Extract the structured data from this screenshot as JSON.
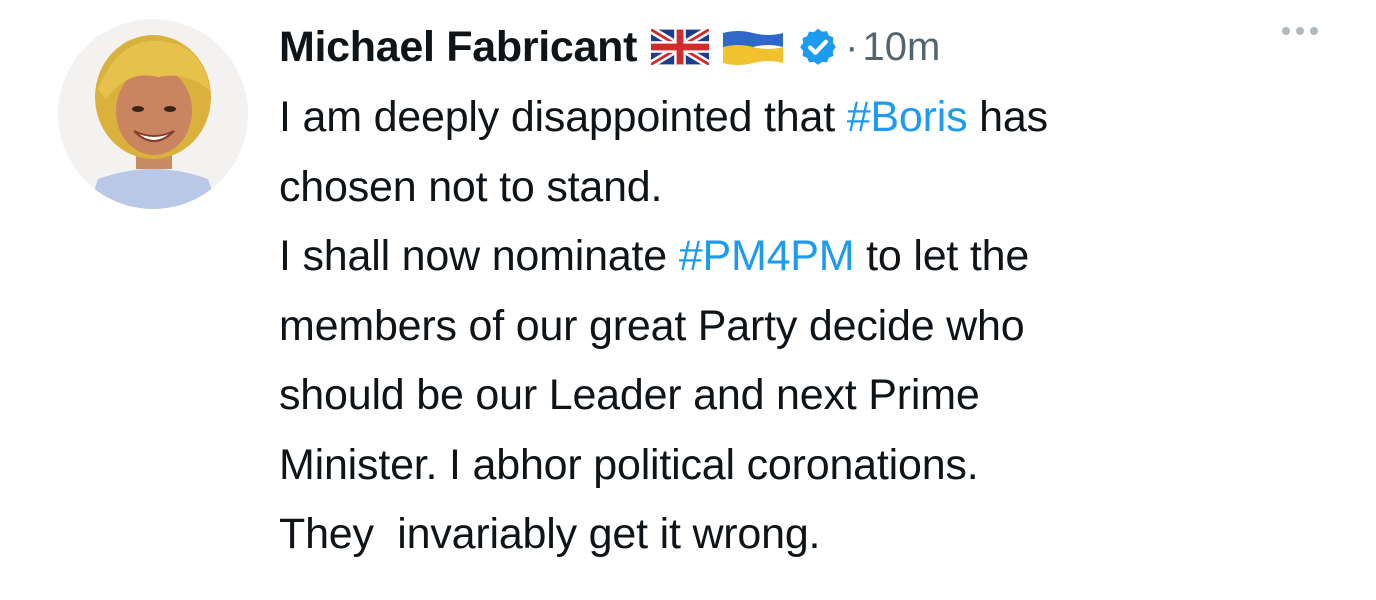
{
  "tweet": {
    "author_name": "Michael Fabricant",
    "flags": [
      "uk-flag-icon",
      "ukraine-flag-icon"
    ],
    "verified_icon": "verified-badge-icon",
    "separator": "·",
    "timestamp": "10m",
    "more_icon": "more-options-icon",
    "colors": {
      "text": "#0f1419",
      "secondary": "#536471",
      "link": "#1d9bf0",
      "verified": "#1d9bf0"
    },
    "body": {
      "l1_a": "I am deeply disappointed that ",
      "l1_tag": "#Boris",
      "l1_b": " has",
      "l2": "chosen not to stand.",
      "l3_a": "I shall now nominate ",
      "l3_tag": "#PM4PM",
      "l3_b": " to let the",
      "l4": "members of our great Party decide who",
      "l5": "should be our Leader and next Prime",
      "l6": "Minister. I abhor political coronations.",
      "l7": "They  invariably get it wrong."
    }
  }
}
